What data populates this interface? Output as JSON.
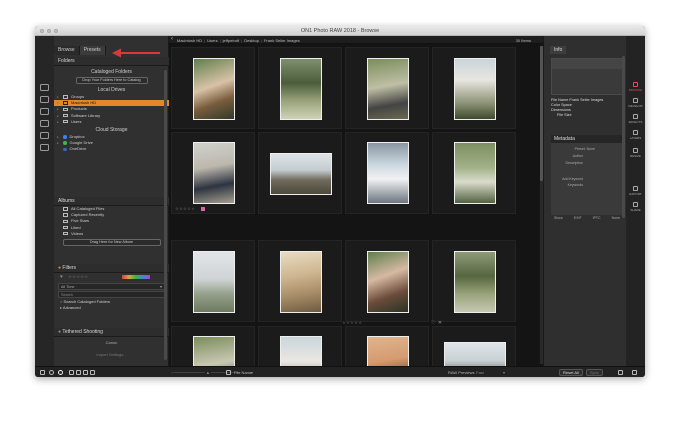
{
  "window": {
    "title": "ON1 Photo RAW 2018 - Browse"
  },
  "pathbar": {
    "back_icon": "chevron-left-icon",
    "crumbs": [
      "Macintosh HD",
      "Users",
      "jeffpetroff",
      "Desktop",
      "Frank Seiler Images"
    ],
    "count": "30 Items"
  },
  "left_tabs": [
    "Browse",
    "Presets"
  ],
  "folders": {
    "title": "Folders",
    "cataloged_title": "Cataloged Folders",
    "drop_catalog": "Drop Your Folders Here to Catalog",
    "local_title": "Local Drives",
    "local_items": [
      "Groups",
      "Macintosh HD",
      "Products",
      "Software Library",
      "Users"
    ],
    "cloud_title": "Cloud Storage",
    "cloud_items": [
      "Dropbox",
      "Google Drive",
      "OneDrive"
    ]
  },
  "albums": {
    "title": "Albums",
    "items": [
      "All Cataloged Files",
      "Captured Recently",
      "Five Stars",
      "Liked",
      "Videos"
    ],
    "drop_album": "Drag Here for New Album"
  },
  "filters": {
    "title": "Filters",
    "dropdown": "All Time",
    "search_placeholder": "Search",
    "search_catalog": "Search Cataloged Folders",
    "advanced": "Advanced"
  },
  "tethered": {
    "title": "Tethered Shooting",
    "camera": "Canon",
    "import_settings": "Import Settings..."
  },
  "grid": {
    "rating_stars": "☆☆☆☆☆"
  },
  "right_panel": {
    "tab": "Info",
    "info_lines": [
      "File Name Frank Seiler Images",
      "Color Space",
      "Dimensions",
      "File Size"
    ],
    "metadata_title": "Metadata",
    "meta_fields": [
      "Preset: None",
      "Author",
      "Description",
      "Add Keyword",
      "Keywords"
    ],
    "meta_buttons": [
      "Show",
      "EXIF",
      "IPTC",
      "None"
    ]
  },
  "modules": [
    "BROWSE",
    "DEVELOP",
    "EFFECTS",
    "LAYERS",
    "RESIZE",
    "EXPORT",
    "SHARE"
  ],
  "bottom": {
    "file_name_label": "File Name",
    "raw_previews_label": "RAW Previews",
    "raw_previews_value": "Fast",
    "reset_all": "Reset All",
    "sync": "Sync"
  },
  "colors": {
    "selected": "#e2882a",
    "accent_red": "#e05050",
    "annotation": "#d83a3a"
  }
}
